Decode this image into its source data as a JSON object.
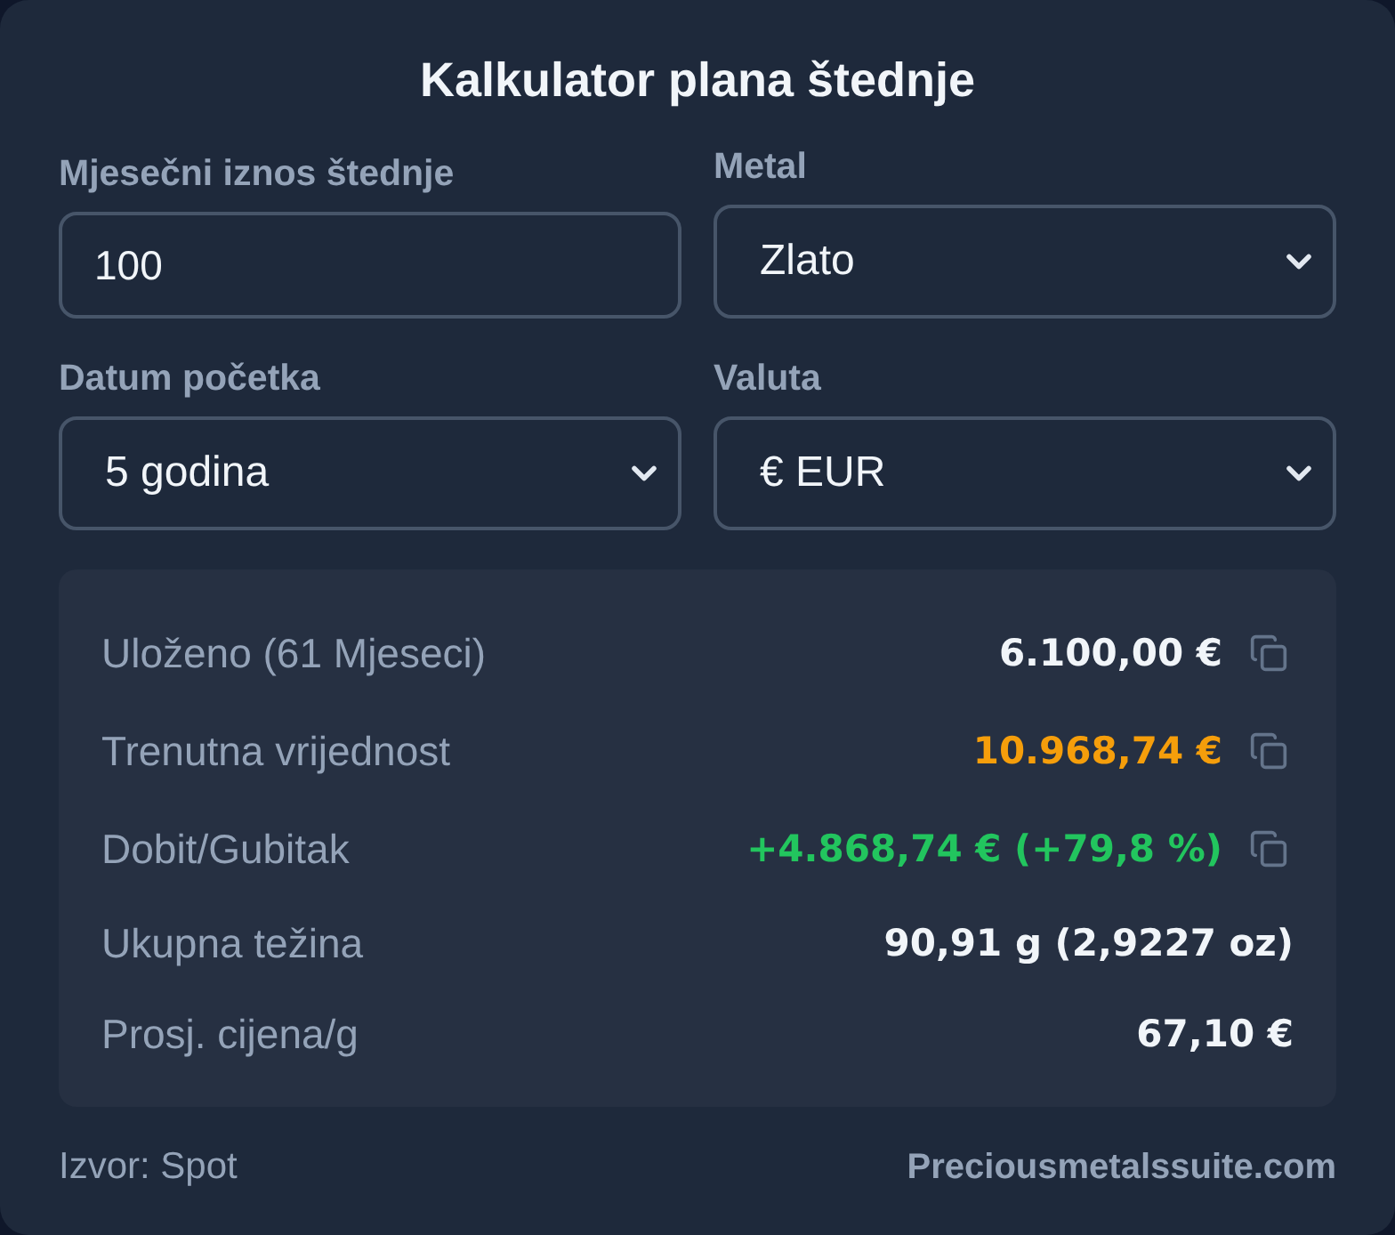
{
  "title": "Kalkulator plana štednje",
  "fields": [
    {
      "kind": "input",
      "label": "Mjesečni iznos štednje",
      "value": "100"
    },
    {
      "kind": "select",
      "label": "Metal",
      "value": "Zlato"
    },
    {
      "kind": "select",
      "label": "Datum početka",
      "value": "5 godina"
    },
    {
      "kind": "select",
      "label": "Valuta",
      "value": "€ EUR"
    }
  ],
  "results": [
    {
      "label": "Uloženo (61 Mjeseci)",
      "value": "6.100,00 €",
      "color": "#f1f5f9",
      "copyable": true
    },
    {
      "label": "Trenutna vrijednost",
      "value": "10.968,74 €",
      "color": "#f59e0b",
      "copyable": true
    },
    {
      "label": "Dobit/Gubitak",
      "value": "+4.868,74 € (+79,8 %)",
      "color": "#22c55e",
      "copyable": true
    },
    {
      "label": "Ukupna težina",
      "value": "90,91 g (2,9227 oz)",
      "color": "#f1f5f9",
      "copyable": false
    },
    {
      "label": "Prosj. cijena/g",
      "value": "67,10 €",
      "color": "#f1f5f9",
      "copyable": false
    }
  ],
  "footer": {
    "source": "Izvor: Spot",
    "link": "Preciousmetalssuite.com"
  }
}
